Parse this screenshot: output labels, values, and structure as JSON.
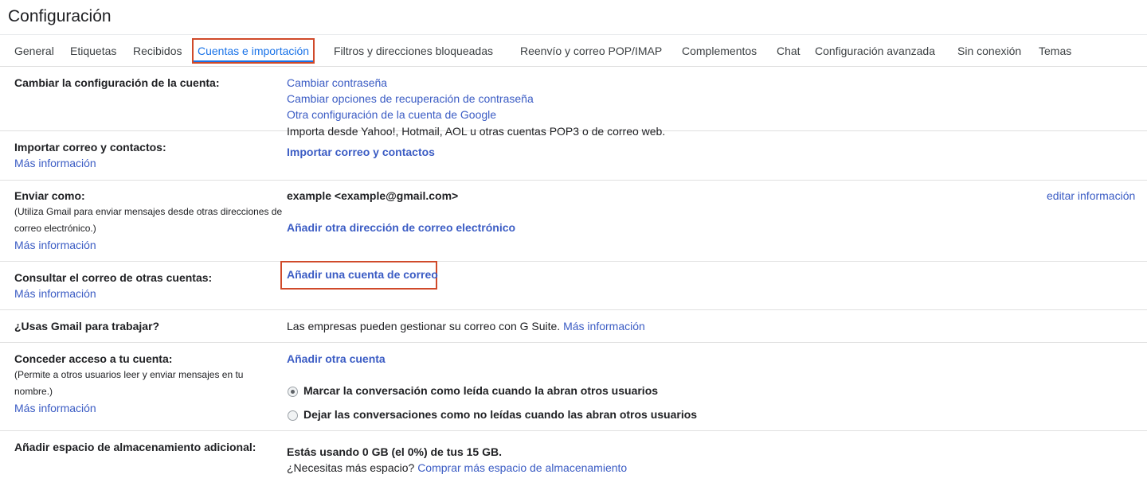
{
  "page": {
    "title": "Configuración"
  },
  "tabs": [
    {
      "label": "General"
    },
    {
      "label": "Etiquetas"
    },
    {
      "label": "Recibidos"
    },
    {
      "label": "Cuentas e importación",
      "active": true
    },
    {
      "label": "Filtros y direcciones bloqueadas"
    },
    {
      "label": "Reenvío y correo POP/IMAP"
    },
    {
      "label": "Complementos"
    },
    {
      "label": "Chat"
    },
    {
      "label": "Configuración avanzada"
    },
    {
      "label": "Sin conexión"
    },
    {
      "label": "Temas"
    }
  ],
  "sections": {
    "account": {
      "label": "Cambiar la configuración de la cuenta:",
      "links": [
        "Cambiar contraseña",
        "Cambiar opciones de recuperación de contraseña",
        "Otra configuración de la cuenta de Google"
      ]
    },
    "import": {
      "label": "Importar correo y contactos:",
      "more": "Más información",
      "description": "Importa desde Yahoo!, Hotmail, AOL u otras cuentas POP3 o de correo web.",
      "action": "Importar correo y contactos"
    },
    "send_as": {
      "label": "Enviar como:",
      "note": "(Utiliza Gmail para enviar mensajes desde otras direcciones de correo electrónico.)",
      "more": "Más información",
      "address": "example <example@gmail.com>",
      "edit": "editar información",
      "action": "Añadir otra dirección de correo electrónico"
    },
    "check_mail": {
      "label": "Consultar el correo de otras cuentas:",
      "more": "Más información",
      "action": "Añadir una cuenta de correo"
    },
    "work": {
      "label": "¿Usas Gmail para trabajar?",
      "text": "Las empresas pueden gestionar su correo con G Suite.",
      "more": "Más información"
    },
    "grant": {
      "label": "Conceder acceso a tu cuenta:",
      "note": "(Permite a otros usuarios leer y enviar mensajes en tu nombre.)",
      "more": "Más información",
      "action": "Añadir otra cuenta",
      "option_read": "Marcar la conversación como leída cuando la abran otros usuarios",
      "option_unread": "Dejar las conversaciones como no leídas cuando las abran otros usuarios",
      "selected": "read"
    },
    "storage": {
      "label": "Añadir espacio de almacenamiento adicional:",
      "usage": "Estás usando 0 GB (el 0%) de tus 15 GB.",
      "question": "¿Necesitas más espacio?",
      "action": "Comprar más espacio de almacenamiento"
    }
  },
  "colors": {
    "link": "#3b5cc4",
    "highlight": "#d04a2a",
    "active_tab": "#1a73e8"
  }
}
